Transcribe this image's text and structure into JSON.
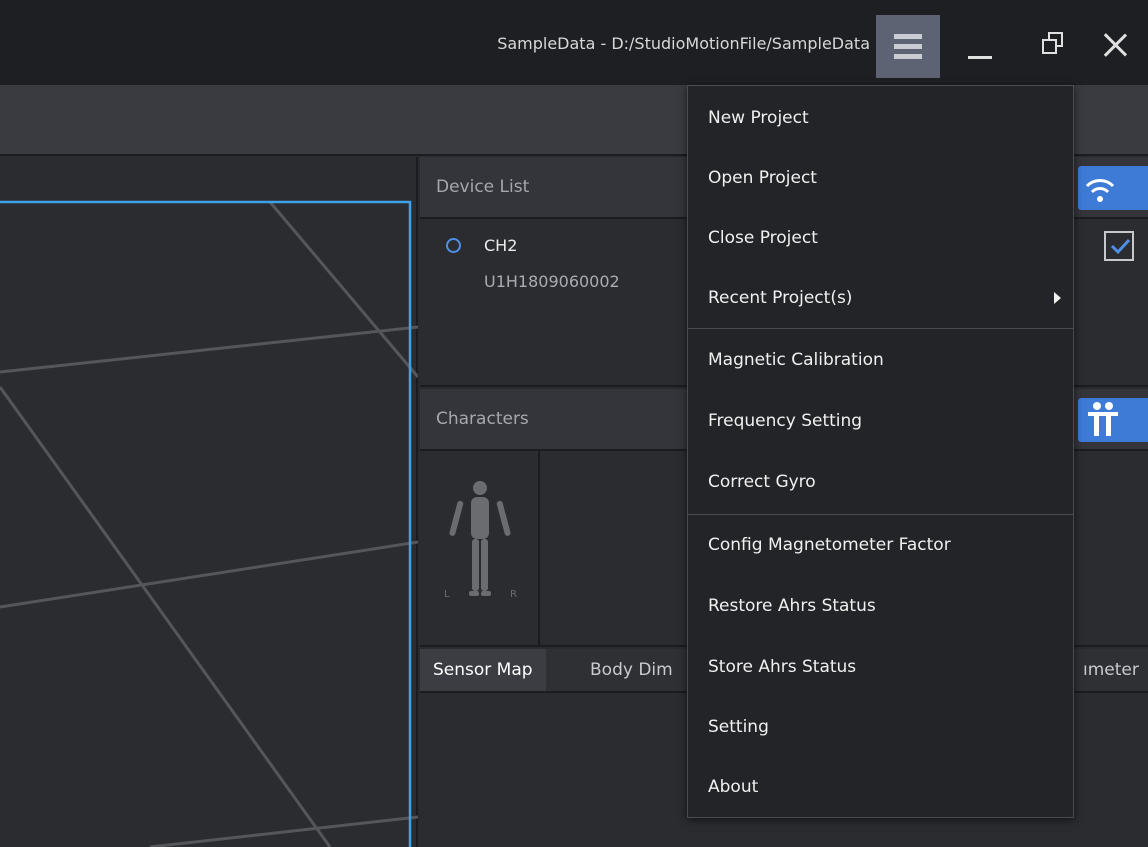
{
  "window": {
    "title": "SampleData - D:/StudioMotionFile/SampleData"
  },
  "colors": {
    "accent": "#3d7bd6",
    "menu_button_bg": "#5d6373",
    "viewport_frame": "#3ea0e8"
  },
  "device_list": {
    "header": "Device List",
    "devices": [
      {
        "name": "CH2",
        "id": "U1H1809060002",
        "checked": true
      }
    ]
  },
  "characters": {
    "header": "Characters",
    "figure_left_label": "L",
    "figure_right_label": "R"
  },
  "tabs": [
    {
      "label": "Sensor Map",
      "active": true
    },
    {
      "label": "Body Dim",
      "active": false
    },
    {
      "label": "ımeter",
      "active": false
    }
  ],
  "menu": {
    "items": [
      {
        "label": "New Project"
      },
      {
        "label": "Open Project"
      },
      {
        "label": "Close Project"
      },
      {
        "label": "Recent Project(s)",
        "submenu": true
      },
      {
        "label": "Magnetic Calibration"
      },
      {
        "label": "Frequency Setting"
      },
      {
        "label": "Correct Gyro"
      },
      {
        "label": "Config Magnetometer Factor"
      },
      {
        "label": "Restore Ahrs Status"
      },
      {
        "label": "Store Ahrs Status"
      },
      {
        "label": "Setting"
      },
      {
        "label": "About"
      }
    ]
  },
  "icons": {
    "menu": "hamburger-icon",
    "minimize": "minimize-icon",
    "maximize": "restore-icon",
    "close": "close-icon",
    "wifi": "wifi-icon",
    "characters": "characters-icon",
    "figure": "human-figure-icon"
  }
}
